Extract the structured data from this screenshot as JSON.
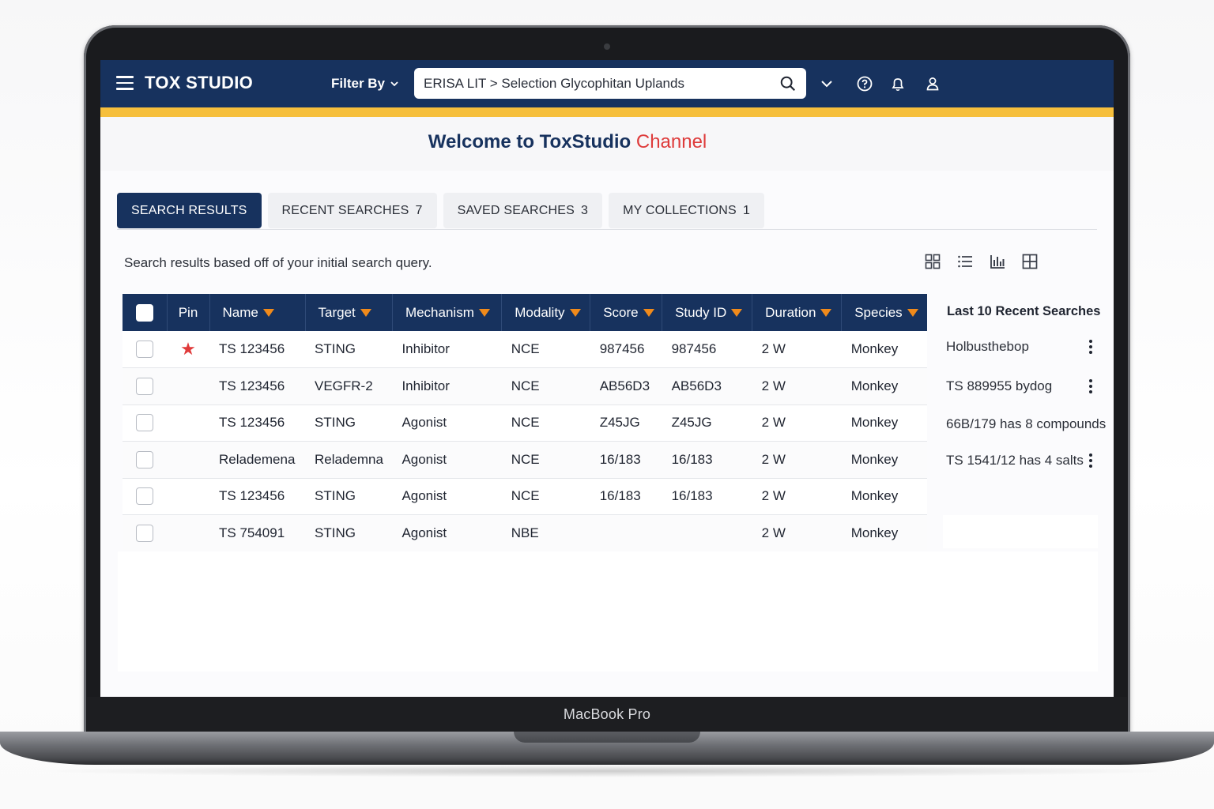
{
  "device": {
    "label": "MacBook Pro"
  },
  "topbar": {
    "title": "TOX STUDIO",
    "filter_label": "Filter By",
    "search_value": "ERISA LIT > Selection Glycophitan Uplands",
    "icons": [
      "menu-icon",
      "chevron-down-icon",
      "search-icon",
      "help-icon",
      "bell-icon",
      "user-icon"
    ]
  },
  "welcome": {
    "main": "Welcome to ToxStudio",
    "highlight": "Channel"
  },
  "tabs": [
    {
      "label": "SEARCH RESULTS",
      "count": ""
    },
    {
      "label": "RECENT SEARCHES",
      "count": "7"
    },
    {
      "label": "SAVED SEARCHES",
      "count": "3"
    },
    {
      "label": "MY COLLECTIONS",
      "count": "1"
    }
  ],
  "hint": "Search results based off of your initial search query.",
  "view_icons": [
    "grid-view-icon",
    "list-view-icon",
    "chart-view-icon",
    "table-view-icon"
  ],
  "table": {
    "headers": [
      "Pin",
      "Name",
      "Target",
      "Mechanism",
      "Modality",
      "Score",
      "Study ID",
      "Duration",
      "Species"
    ],
    "rows": [
      {
        "pin": "★",
        "name": "TS 123456",
        "target": "STING",
        "mechanism": "Inhibitor",
        "modality": "NCE",
        "score": "987456",
        "study": "987456",
        "duration": "2 W",
        "species": "Monkey"
      },
      {
        "pin": "",
        "name": "TS 123456",
        "target": "VEGFR-2",
        "mechanism": "Inhibitor",
        "modality": "NCE",
        "score": "AB56D3",
        "study": "AB56D3",
        "duration": "2 W",
        "species": "Monkey"
      },
      {
        "pin": "",
        "name": "TS 123456",
        "target": "STING",
        "mechanism": "Agonist",
        "modality": "NCE",
        "score": "Z45JG",
        "study": "Z45JG",
        "duration": "2 W",
        "species": "Monkey"
      },
      {
        "pin": "",
        "name": "Relademena",
        "target": "Relademna",
        "mechanism": "Agonist",
        "modality": "NCE",
        "score": "16/183",
        "study": "16/183",
        "duration": "2 W",
        "species": "Monkey"
      },
      {
        "pin": "",
        "name": "TS 123456",
        "target": "STING",
        "mechanism": "Agonist",
        "modality": "NCE",
        "score": "16/183",
        "study": "16/183",
        "duration": "2 W",
        "species": "Monkey"
      },
      {
        "pin": "",
        "name": "TS 754091",
        "target": "STING",
        "mechanism": "Agonist",
        "modality": "NBE",
        "score": "",
        "study": "",
        "duration": "2 W",
        "species": "Monkey"
      }
    ]
  },
  "recent": {
    "title": "Last 10 Recent Searches",
    "items": [
      "Holbusthebop",
      "TS 889955 bydog",
      "66B/179 has 8 compounds",
      "TS 1541/12 has 4 salts"
    ]
  },
  "colors": {
    "navy": "#17325e",
    "accent": "#f6bf3c",
    "sort_arrow": "#f08a1b",
    "highlight": "#de3b3b"
  }
}
